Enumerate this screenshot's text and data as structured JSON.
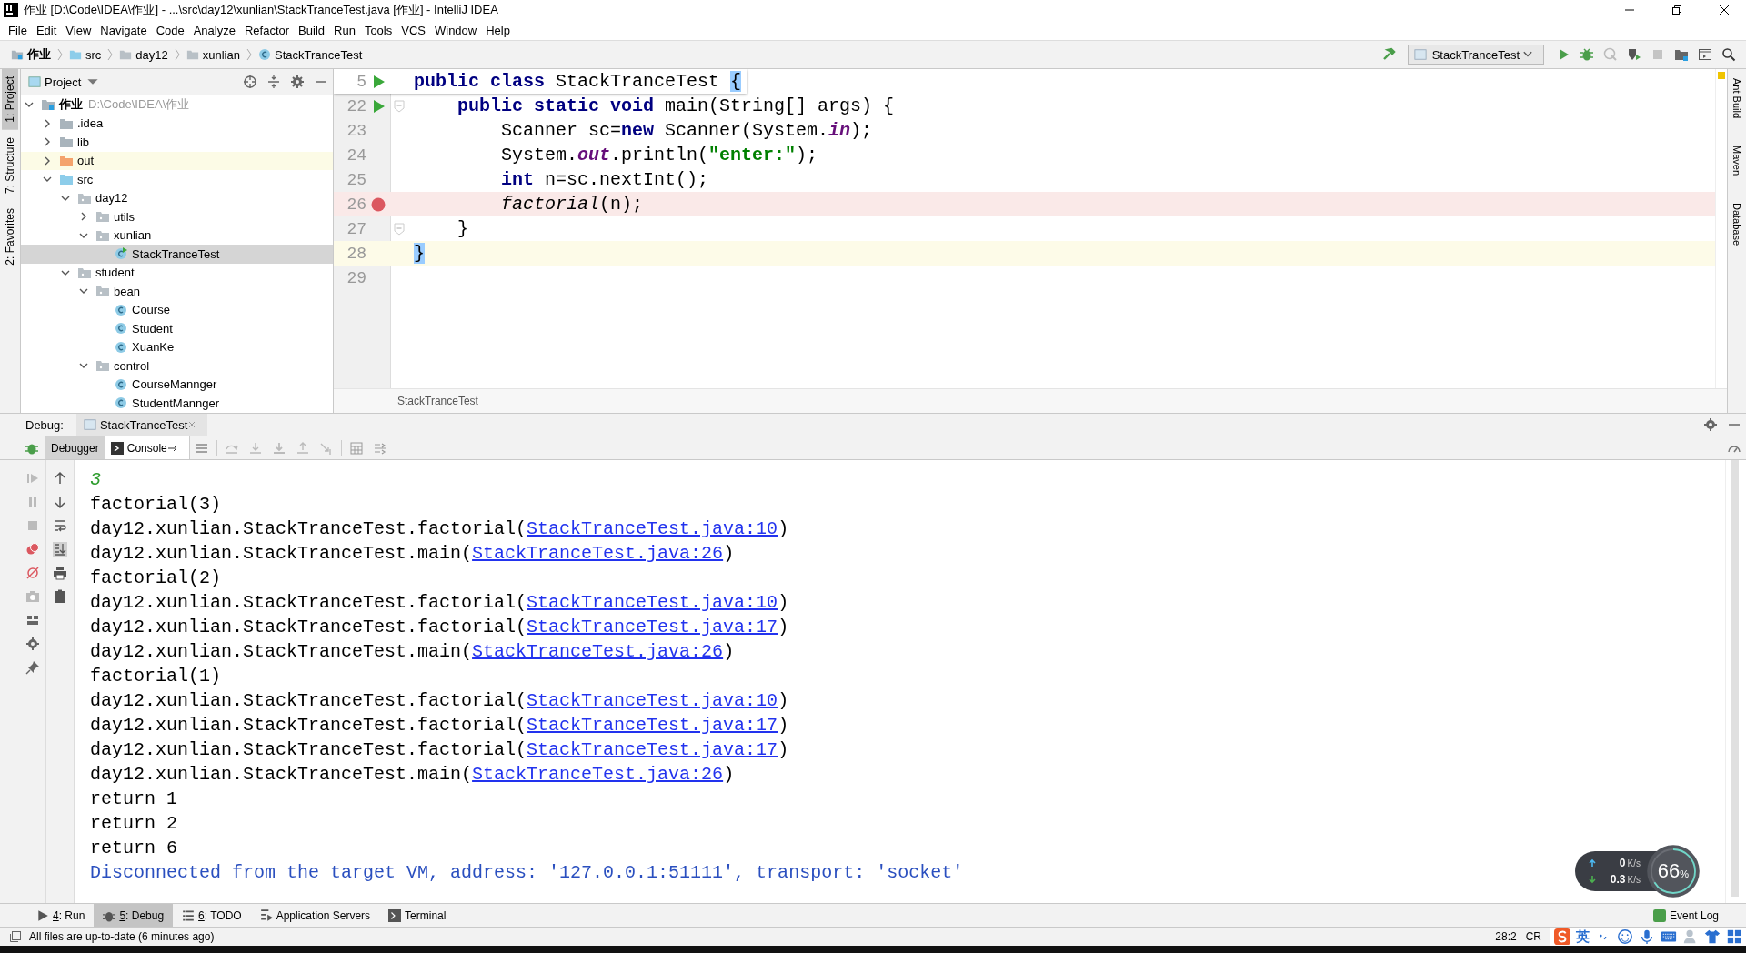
{
  "window": {
    "title": "作业 [D:\\Code\\IDEA\\作业] - ...\\src\\day12\\xunlian\\StackTranceTest.java [作业] - IntelliJ IDEA"
  },
  "menu": [
    "File",
    "Edit",
    "View",
    "Navigate",
    "Code",
    "Analyze",
    "Refactor",
    "Build",
    "Run",
    "Tools",
    "VCS",
    "Window",
    "Help"
  ],
  "breadcrumb": [
    {
      "label": "作业",
      "kind": "module"
    },
    {
      "label": "src",
      "kind": "source"
    },
    {
      "label": "day12",
      "kind": "package"
    },
    {
      "label": "xunlian",
      "kind": "package"
    },
    {
      "label": "StackTranceTest",
      "kind": "class"
    }
  ],
  "run_config": "StackTranceTest",
  "left_tool_tabs": [
    {
      "label": "1: Project",
      "selected": true
    },
    {
      "label": "7: Structure",
      "selected": false
    },
    {
      "label": "2: Favorites",
      "selected": false
    }
  ],
  "right_tool_tabs": [
    "Ant Build",
    "Maven",
    "Database"
  ],
  "project": {
    "title": "Project",
    "tree": [
      {
        "label": "作业",
        "path": "D:\\Code\\IDEA\\作业",
        "kind": "module",
        "expanded": true,
        "selected": false,
        "children": [
          {
            "label": ".idea",
            "kind": "folder",
            "expanded": false,
            "selected": false
          },
          {
            "label": "lib",
            "kind": "folder",
            "expanded": false,
            "selected": false
          },
          {
            "label": "out",
            "kind": "excluded",
            "expanded": false,
            "selected": false
          },
          {
            "label": "src",
            "kind": "source",
            "expanded": true,
            "selected": false,
            "children": [
              {
                "label": "day12",
                "kind": "package",
                "expanded": true,
                "selected": false,
                "children": [
                  {
                    "label": "utils",
                    "kind": "package",
                    "expanded": false,
                    "selected": false
                  },
                  {
                    "label": "xunlian",
                    "kind": "package",
                    "expanded": true,
                    "selected": false,
                    "children": [
                      {
                        "label": "StackTranceTest",
                        "kind": "main-class",
                        "selected": true
                      }
                    ]
                  }
                ]
              },
              {
                "label": "student",
                "kind": "package",
                "expanded": true,
                "selected": false,
                "children": [
                  {
                    "label": "bean",
                    "kind": "package",
                    "expanded": true,
                    "selected": false,
                    "children": [
                      {
                        "label": "Course",
                        "kind": "class",
                        "selected": false
                      },
                      {
                        "label": "Student",
                        "kind": "class",
                        "selected": false
                      },
                      {
                        "label": "XuanKe",
                        "kind": "class",
                        "selected": false
                      }
                    ]
                  },
                  {
                    "label": "control",
                    "kind": "package",
                    "expanded": true,
                    "selected": false,
                    "children": [
                      {
                        "label": "CourseMannger",
                        "kind": "class",
                        "selected": false
                      },
                      {
                        "label": "StudentMannger",
                        "kind": "class",
                        "selected": false
                      }
                    ]
                  }
                ]
              }
            ]
          }
        ]
      }
    ]
  },
  "editor": {
    "sticky_line": {
      "number": "5",
      "run": true,
      "code": [
        {
          "text": "public class",
          "kind": "keyword"
        },
        {
          "text": " StackTranceTest ",
          "kind": "plain"
        },
        {
          "text": "{",
          "kind": "brace"
        }
      ]
    },
    "lines": [
      {
        "number": "22",
        "run": true,
        "fold": true,
        "breakpoint": false,
        "current": false,
        "code": [
          {
            "text": "    public static void",
            "kind": "keyword"
          },
          {
            "text": " main(String[] args) {",
            "kind": "plain"
          }
        ]
      },
      {
        "number": "23",
        "run": false,
        "fold": false,
        "breakpoint": false,
        "current": false,
        "code": [
          {
            "text": "        Scanner sc=",
            "kind": "plain"
          },
          {
            "text": "new",
            "kind": "keyword"
          },
          {
            "text": " Scanner(System.",
            "kind": "plain"
          },
          {
            "text": "in",
            "kind": "static"
          },
          {
            "text": ");",
            "kind": "plain"
          }
        ]
      },
      {
        "number": "24",
        "run": false,
        "fold": false,
        "breakpoint": false,
        "current": false,
        "code": [
          {
            "text": "        System.",
            "kind": "plain"
          },
          {
            "text": "out",
            "kind": "static"
          },
          {
            "text": ".println(",
            "kind": "plain"
          },
          {
            "text": "\"enter:\"",
            "kind": "string"
          },
          {
            "text": ");",
            "kind": "plain"
          }
        ]
      },
      {
        "number": "25",
        "run": false,
        "fold": false,
        "breakpoint": false,
        "current": false,
        "code": [
          {
            "text": "        int",
            "kind": "keyword"
          },
          {
            "text": " n=sc.nextInt();",
            "kind": "plain"
          }
        ]
      },
      {
        "number": "26",
        "run": false,
        "fold": false,
        "breakpoint": true,
        "current": false,
        "code": [
          {
            "text": "        factorial",
            "kind": "italic"
          },
          {
            "text": "(n);",
            "kind": "plain"
          }
        ]
      },
      {
        "number": "27",
        "run": false,
        "fold": true,
        "breakpoint": false,
        "current": false,
        "code": [
          {
            "text": "    }",
            "kind": "plain"
          }
        ]
      },
      {
        "number": "28",
        "run": false,
        "fold": false,
        "breakpoint": false,
        "current": true,
        "code": [
          {
            "text": "}",
            "kind": "brace"
          }
        ]
      },
      {
        "number": "29",
        "run": false,
        "fold": false,
        "breakpoint": false,
        "current": false
      }
    ],
    "breadcrumb": "StackTranceTest"
  },
  "debug": {
    "label": "Debug:",
    "session": "StackTranceTest",
    "tabs": [
      {
        "label": "Debugger",
        "selected": false
      },
      {
        "label": "Console",
        "selected": true
      }
    ],
    "console": [
      {
        "kind": "input",
        "text": "3"
      },
      {
        "kind": "output",
        "text": "factorial(3)"
      },
      {
        "kind": "trace",
        "text": "day12.xunlian.StackTranceTest.factorial(",
        "link": "StackTranceTest.java:10",
        "end": ")"
      },
      {
        "kind": "trace",
        "text": "day12.xunlian.StackTranceTest.main(",
        "link": "StackTranceTest.java:26",
        "end": ")"
      },
      {
        "kind": "output",
        "text": "factorial(2)"
      },
      {
        "kind": "trace",
        "text": "day12.xunlian.StackTranceTest.factorial(",
        "link": "StackTranceTest.java:10",
        "end": ")"
      },
      {
        "kind": "trace",
        "text": "day12.xunlian.StackTranceTest.factorial(",
        "link": "StackTranceTest.java:17",
        "end": ")"
      },
      {
        "kind": "trace",
        "text": "day12.xunlian.StackTranceTest.main(",
        "link": "StackTranceTest.java:26",
        "end": ")"
      },
      {
        "kind": "output",
        "text": "factorial(1)"
      },
      {
        "kind": "trace",
        "text": "day12.xunlian.StackTranceTest.factorial(",
        "link": "StackTranceTest.java:10",
        "end": ")"
      },
      {
        "kind": "trace",
        "text": "day12.xunlian.StackTranceTest.factorial(",
        "link": "StackTranceTest.java:17",
        "end": ")"
      },
      {
        "kind": "trace",
        "text": "day12.xunlian.StackTranceTest.factorial(",
        "link": "StackTranceTest.java:17",
        "end": ")"
      },
      {
        "kind": "trace",
        "text": "day12.xunlian.StackTranceTest.main(",
        "link": "StackTranceTest.java:26",
        "end": ")"
      },
      {
        "kind": "output",
        "text": "return 1"
      },
      {
        "kind": "output",
        "text": "return 2"
      },
      {
        "kind": "output",
        "text": "return 6"
      },
      {
        "kind": "system",
        "text": "Disconnected from the target VM, address: '127.0.0.1:51111', transport: 'socket'"
      }
    ]
  },
  "bottom_tabs": [
    {
      "number": "4",
      "label": ": Run",
      "kind": "run",
      "selected": false
    },
    {
      "number": "5",
      "label": ": Debug",
      "kind": "debug",
      "selected": true
    },
    {
      "number": "6",
      "label": ": TODO",
      "kind": "todo",
      "selected": false
    },
    {
      "label": "Application Servers",
      "kind": "servers",
      "selected": false
    },
    {
      "label": "Terminal",
      "kind": "terminal",
      "selected": false
    }
  ],
  "event_log": "Event Log",
  "status_bar": {
    "message": "All files are up-to-date (6 minutes ago)",
    "position": "28:2",
    "line_separator": "CR",
    "ime_mode": "英"
  },
  "net_monitor": {
    "upload": "0",
    "upload_unit": "K/s",
    "download": "0.3",
    "download_unit": "K/s",
    "percent": "66",
    "percent_sign": "%"
  }
}
